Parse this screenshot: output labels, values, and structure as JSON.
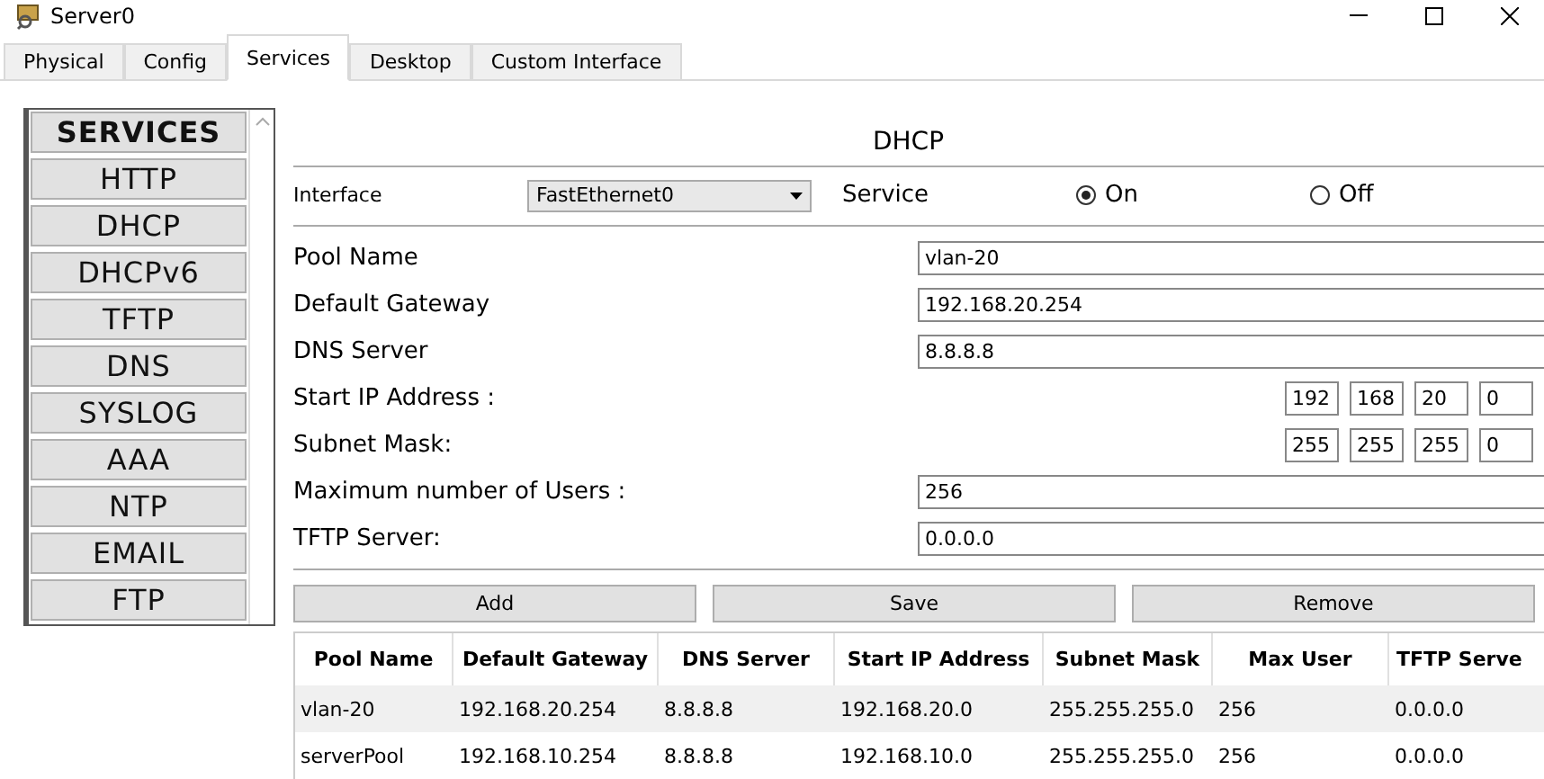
{
  "window": {
    "title": "Server0"
  },
  "tabs": [
    {
      "label": "Physical",
      "selected": false
    },
    {
      "label": "Config",
      "selected": false
    },
    {
      "label": "Services",
      "selected": true
    },
    {
      "label": "Desktop",
      "selected": false
    },
    {
      "label": "Custom Interface",
      "selected": false
    }
  ],
  "sidebar": {
    "header": "SERVICES",
    "items": [
      "HTTP",
      "DHCP",
      "DHCPv6",
      "TFTP",
      "DNS",
      "SYSLOG",
      "AAA",
      "NTP",
      "EMAIL",
      "FTP"
    ]
  },
  "panel": {
    "title": "DHCP",
    "interface_label": "Interface",
    "interface_value": "FastEthernet0",
    "service_label": "Service",
    "service_options": [
      {
        "label": "On",
        "selected": true
      },
      {
        "label": "Off",
        "selected": false
      }
    ],
    "fields": [
      {
        "kind": "text",
        "label": "Pool Name",
        "value": "vlan-20"
      },
      {
        "kind": "text",
        "label": "Default Gateway",
        "value": "192.168.20.254"
      },
      {
        "kind": "text",
        "label": "DNS Server",
        "value": "8.8.8.8"
      },
      {
        "kind": "octets",
        "label": "Start IP Address :",
        "octets": [
          "192",
          "168",
          "20",
          "0"
        ]
      },
      {
        "kind": "octets",
        "label": "Subnet Mask:",
        "octets": [
          "255",
          "255",
          "255",
          "0"
        ]
      },
      {
        "kind": "text",
        "label": "Maximum number of Users :",
        "value": "256"
      },
      {
        "kind": "text",
        "label": "TFTP Server:",
        "value": "0.0.0.0"
      }
    ],
    "buttons": [
      "Add",
      "Save",
      "Remove"
    ]
  },
  "table": {
    "columns": [
      "Pool Name",
      "Default Gateway",
      "DNS Server",
      "Start IP Address",
      "Subnet Mask",
      "Max User",
      "TFTP Serve"
    ],
    "rows": [
      [
        "vlan-20",
        "192.168.20.254",
        "8.8.8.8",
        "192.168.20.0",
        "255.255.255.0",
        "256",
        "0.0.0.0"
      ],
      [
        "serverPool",
        "192.168.10.254",
        "8.8.8.8",
        "192.168.10.0",
        "255.255.255.0",
        "256",
        "0.0.0.0"
      ]
    ]
  }
}
